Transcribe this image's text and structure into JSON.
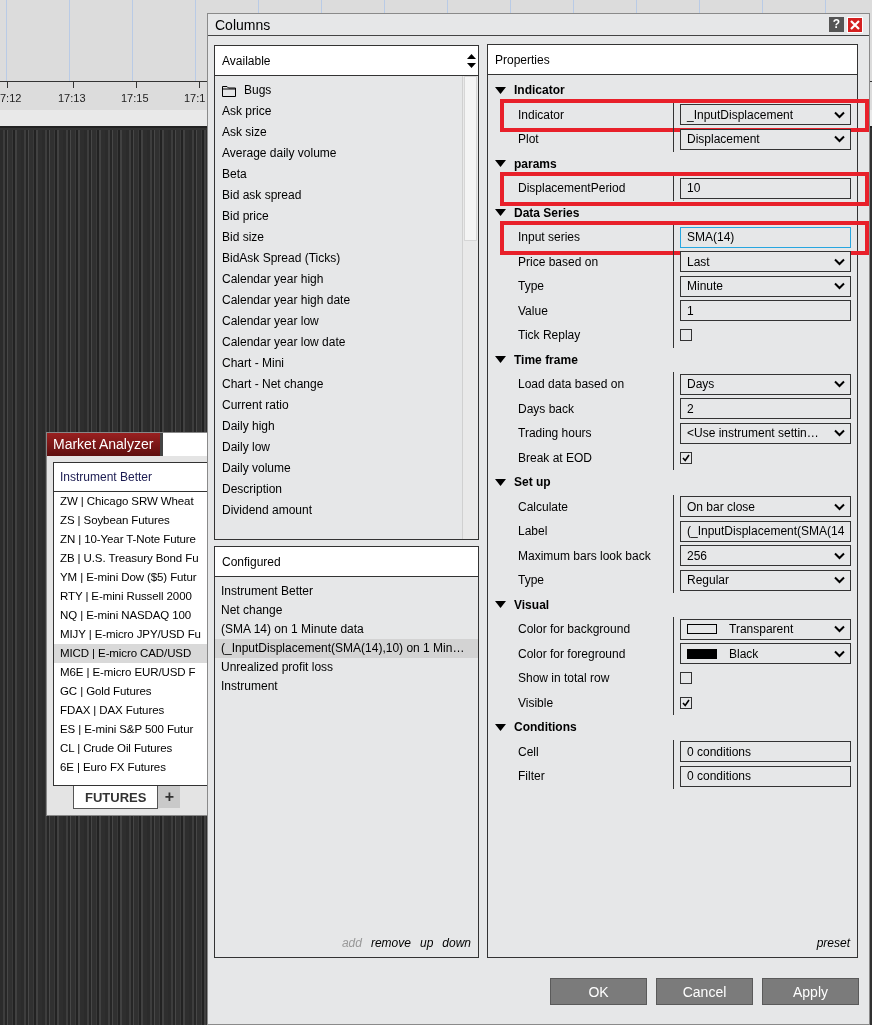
{
  "chart": {
    "time_labels": [
      "7:12",
      "17:13",
      "17:15",
      "17:1"
    ]
  },
  "market_analyzer": {
    "title": "Market Analyzer",
    "column": "Instrument Better",
    "rows": [
      {
        "text": "ZW | Chicago SRW Wheat",
        "selected": false
      },
      {
        "text": "ZS | Soybean Futures",
        "selected": false
      },
      {
        "text": "ZN | 10-Year T-Note Future",
        "selected": false
      },
      {
        "text": "ZB | U.S. Treasury Bond Fu",
        "selected": false
      },
      {
        "text": "YM | E-mini Dow ($5) Futur",
        "selected": false
      },
      {
        "text": "RTY | E-mini Russell 2000",
        "selected": false
      },
      {
        "text": "NQ | E-mini NASDAQ 100",
        "selected": false
      },
      {
        "text": "MIJY | E-micro JPY/USD Fu",
        "selected": false
      },
      {
        "text": "MICD | E-micro CAD/USD",
        "selected": true
      },
      {
        "text": "M6E | E-micro EUR/USD F",
        "selected": false
      },
      {
        "text": "GC | Gold Futures",
        "selected": false
      },
      {
        "text": "FDAX | DAX Futures",
        "selected": false
      },
      {
        "text": "ES | E-mini S&P 500 Futur",
        "selected": false
      },
      {
        "text": "CL | Crude Oil Futures",
        "selected": false
      },
      {
        "text": "6E | Euro FX Futures",
        "selected": false
      }
    ],
    "tabs": [
      {
        "label": "FUTURES",
        "selected": true
      }
    ],
    "add_tab": "+"
  },
  "dialog": {
    "title": "Columns",
    "help": "?",
    "available": {
      "title": "Available",
      "items": [
        {
          "kind": "folder",
          "label": "Bugs"
        },
        {
          "kind": "item",
          "label": "Ask price"
        },
        {
          "kind": "item",
          "label": "Ask size"
        },
        {
          "kind": "item",
          "label": "Average daily volume"
        },
        {
          "kind": "item",
          "label": "Beta"
        },
        {
          "kind": "item",
          "label": "Bid ask spread"
        },
        {
          "kind": "item",
          "label": "Bid price"
        },
        {
          "kind": "item",
          "label": "Bid size"
        },
        {
          "kind": "item",
          "label": "BidAsk Spread (Ticks)"
        },
        {
          "kind": "item",
          "label": "Calendar year high"
        },
        {
          "kind": "item",
          "label": "Calendar year high date"
        },
        {
          "kind": "item",
          "label": "Calendar year low"
        },
        {
          "kind": "item",
          "label": "Calendar year low date"
        },
        {
          "kind": "item",
          "label": "Chart - Mini"
        },
        {
          "kind": "item",
          "label": "Chart - Net change"
        },
        {
          "kind": "item",
          "label": "Current ratio"
        },
        {
          "kind": "item",
          "label": "Daily high"
        },
        {
          "kind": "item",
          "label": "Daily low"
        },
        {
          "kind": "item",
          "label": "Daily volume"
        },
        {
          "kind": "item",
          "label": "Description"
        },
        {
          "kind": "item",
          "label": "Dividend amount"
        }
      ]
    },
    "configured": {
      "title": "Configured",
      "items": [
        {
          "label": "Instrument Better",
          "selected": false
        },
        {
          "label": "Net change",
          "selected": false
        },
        {
          "label": "(SMA 14) on 1 Minute data",
          "selected": false
        },
        {
          "label": "(_InputDisplacement(SMA(14),10) on 1 Min…",
          "selected": true
        },
        {
          "label": "Unrealized profit loss",
          "selected": false
        },
        {
          "label": "Instrument",
          "selected": false
        }
      ],
      "actions": [
        {
          "label": "add",
          "disabled": true
        },
        {
          "label": "remove",
          "disabled": false
        },
        {
          "label": "up",
          "disabled": false
        },
        {
          "label": "down",
          "disabled": false
        }
      ]
    },
    "properties": {
      "title": "Properties",
      "sections": [
        {
          "title": "Indicator",
          "expanded": true,
          "rows": [
            {
              "label": "Indicator",
              "kind": "dropdown",
              "value": "_InputDisplacement",
              "highlighted": true
            },
            {
              "label": "Plot",
              "kind": "dropdown",
              "value": "Displacement",
              "highlighted": false
            }
          ]
        },
        {
          "title": "params",
          "expanded": true,
          "rows": [
            {
              "label": "DisplacementPeriod",
              "kind": "text",
              "value": "10",
              "highlighted": true
            }
          ]
        },
        {
          "title": "Data Series",
          "expanded": true,
          "rows": [
            {
              "label": "Input series",
              "kind": "text",
              "value": "SMA(14)",
              "highlighted": true,
              "focused": true
            },
            {
              "label": "Price based on",
              "kind": "dropdown",
              "value": "Last",
              "highlighted": false
            },
            {
              "label": "Type",
              "kind": "dropdown",
              "value": "Minute",
              "highlighted": false
            },
            {
              "label": "Value",
              "kind": "text",
              "value": "1",
              "highlighted": false
            },
            {
              "label": "Tick Replay",
              "kind": "checkbox",
              "checked": false,
              "highlighted": false
            }
          ]
        },
        {
          "title": "Time frame",
          "expanded": true,
          "rows": [
            {
              "label": "Load data based on",
              "kind": "dropdown",
              "value": "Days",
              "highlighted": false
            },
            {
              "label": "Days back",
              "kind": "text",
              "value": "2",
              "highlighted": false
            },
            {
              "label": "Trading hours",
              "kind": "dropdown",
              "value": "<Use instrument settin…",
              "highlighted": false
            },
            {
              "label": "Break at EOD",
              "kind": "checkbox",
              "checked": true,
              "highlighted": false
            }
          ]
        },
        {
          "title": "Set up",
          "expanded": true,
          "rows": [
            {
              "label": "Calculate",
              "kind": "dropdown",
              "value": "On bar close",
              "highlighted": false
            },
            {
              "label": "Label",
              "kind": "text",
              "value": "(_InputDisplacement(SMA(14",
              "highlighted": false
            },
            {
              "label": "Maximum bars look back",
              "kind": "dropdown",
              "value": "256",
              "highlighted": false
            },
            {
              "label": "Type",
              "kind": "dropdown",
              "value": "Regular",
              "highlighted": false
            }
          ]
        },
        {
          "title": "Visual",
          "expanded": true,
          "rows": [
            {
              "label": "Color for background",
              "kind": "color",
              "value": "Transparent",
              "highlighted": false
            },
            {
              "label": "Color for foreground",
              "kind": "color",
              "value": "Black",
              "color": "#000000",
              "highlighted": false
            },
            {
              "label": "Show in total row",
              "kind": "checkbox",
              "checked": false,
              "highlighted": false
            },
            {
              "label": "Visible",
              "kind": "checkbox",
              "checked": true,
              "highlighted": false
            }
          ]
        },
        {
          "title": "Conditions",
          "expanded": true,
          "rows": [
            {
              "label": "Cell",
              "kind": "text",
              "value": "0 conditions",
              "highlighted": false
            },
            {
              "label": "Filter",
              "kind": "text",
              "value": "0 conditions",
              "highlighted": false
            }
          ]
        }
      ],
      "preset": "preset"
    },
    "buttons": [
      {
        "label": "OK"
      },
      {
        "label": "Cancel"
      },
      {
        "label": "Apply"
      }
    ]
  }
}
